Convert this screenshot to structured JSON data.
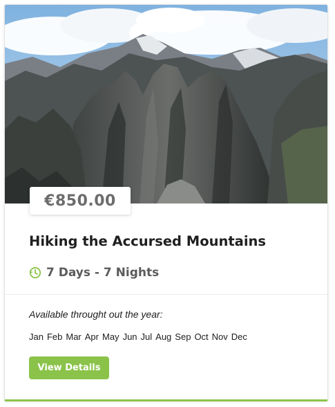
{
  "tour": {
    "image_icon": "mountains-photo",
    "price": "€850.00",
    "title": "Hiking the Accursed Mountains",
    "duration_icon": "clock-icon",
    "duration": "7 Days - 7 Nights",
    "availability_label": "Available throught out the year:",
    "months": [
      "Jan",
      "Feb",
      "Mar",
      "Apr",
      "May",
      "Jun",
      "Jul",
      "Aug",
      "Sep",
      "Oct",
      "Nov",
      "Dec"
    ],
    "button_label": "View Details"
  },
  "colors": {
    "accent": "#8bc34a",
    "price_text": "#6c6c6c",
    "title_text": "#1f1f1f"
  }
}
